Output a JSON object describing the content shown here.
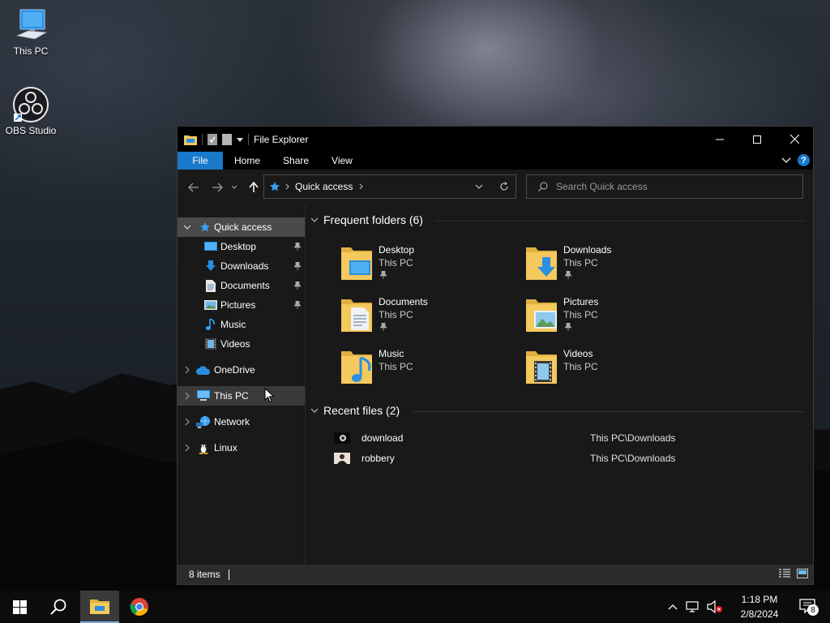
{
  "desktop": {
    "icons": [
      {
        "label": "This PC"
      },
      {
        "label": "OBS Studio"
      }
    ]
  },
  "window": {
    "title": "File Explorer",
    "ribbon_tabs": [
      "File",
      "Home",
      "Share",
      "View"
    ],
    "help_label": "?",
    "address": {
      "crumb": "Quick access"
    },
    "search": {
      "placeholder": "Search Quick access"
    }
  },
  "nav": {
    "quick_access": "Quick access",
    "pinned": [
      {
        "label": "Desktop",
        "icon": "desktop-icon",
        "pinned": true
      },
      {
        "label": "Downloads",
        "icon": "downloads-icon",
        "pinned": true
      },
      {
        "label": "Documents",
        "icon": "documents-icon",
        "pinned": true
      },
      {
        "label": "Pictures",
        "icon": "pictures-icon",
        "pinned": true
      },
      {
        "label": "Music",
        "icon": "music-icon",
        "pinned": false
      },
      {
        "label": "Videos",
        "icon": "videos-icon",
        "pinned": false
      }
    ],
    "onedrive": "OneDrive",
    "this_pc": "This PC",
    "network": "Network",
    "linux": "Linux"
  },
  "content": {
    "frequent_header": "Frequent folders (6)",
    "frequent": [
      {
        "name": "Desktop",
        "location": "This PC",
        "pinned": true
      },
      {
        "name": "Downloads",
        "location": "This PC",
        "pinned": true
      },
      {
        "name": "Documents",
        "location": "This PC",
        "pinned": true
      },
      {
        "name": "Pictures",
        "location": "This PC",
        "pinned": true
      },
      {
        "name": "Music",
        "location": "This PC",
        "pinned": false
      },
      {
        "name": "Videos",
        "location": "This PC",
        "pinned": false
      }
    ],
    "recent_header": "Recent files (2)",
    "recent": [
      {
        "name": "download",
        "path": "This PC\\Downloads"
      },
      {
        "name": "robbery",
        "path": "This PC\\Downloads"
      }
    ]
  },
  "status": {
    "items": "8 items"
  },
  "taskbar": {
    "time": "1:18 PM",
    "date": "2/8/2024",
    "notifications": "8"
  },
  "colors": {
    "accent": "#1979ca",
    "window_bg": "#191919",
    "titlebar_bg": "#000000",
    "folder_yellow": "#f4c95d"
  }
}
